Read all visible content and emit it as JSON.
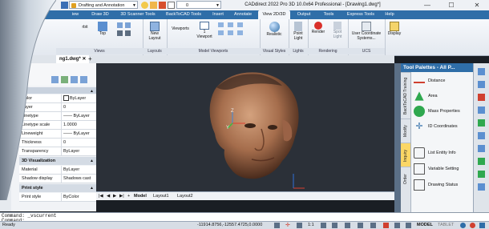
{
  "titlebar": {
    "workspace": "Drafting and Annotation",
    "layer_value": "0",
    "title": "CADdirect 2022 Pro 3D 10.0x64 Professional - [Drawing1.dwg*]"
  },
  "ribbon_tabs": [
    "iew",
    "Draw 3D",
    "3D Scanner Tools",
    "BackToCAD Tools",
    "Insert",
    "Annotate",
    "View 2D/3D",
    "Output",
    "Tools",
    "Express Tools",
    "Help"
  ],
  "active_tab": "View 2D/3D",
  "ribbon": {
    "groups": {
      "views": "Views",
      "layouts": "Layouts",
      "model_viewports": "Model Viewports",
      "visual_styles": "Visual Styles",
      "lights": "Lights",
      "rendering": "Rendering",
      "ucs": "UCS"
    },
    "orbit": "rbit",
    "top": "Top",
    "new_layout": "New Layout",
    "viewports": "Viewports",
    "one_viewport": "1 Viewport",
    "realistic": "Realistic",
    "point_light": "Point Light",
    "render": "Render",
    "spot_light": "Spot Light",
    "user_coordinate": "User Coordinate Systems...",
    "display": "Display"
  },
  "document_tab": "ng1.dwg*",
  "properties": {
    "general_rows": [
      {
        "key": "Color",
        "value": "ByLayer"
      },
      {
        "key": "Layer",
        "value": "0"
      },
      {
        "key": "Linetype",
        "value": "—— ByLayer"
      },
      {
        "key": "Linetype scale",
        "value": "1.0000"
      },
      {
        "key": "Lineweight",
        "value": "—— ByLayer"
      },
      {
        "key": "Thickness",
        "value": "0"
      },
      {
        "key": "Transparency",
        "value": "ByLayer"
      }
    ],
    "section_3d": "3D Visualization",
    "rows_3d": [
      {
        "key": "Material",
        "value": "ByLayer"
      },
      {
        "key": "Shadow display",
        "value": "Shadows cast"
      }
    ],
    "section_print": "Print style",
    "rows_print": [
      {
        "key": "Print style",
        "value": "ByColor"
      }
    ]
  },
  "viewport": {
    "axis_z": "Z",
    "axis_y": "Y"
  },
  "layout_tabs": [
    "Model",
    "Layout1",
    "Layout2"
  ],
  "tool_palette": {
    "title": "Tool Palettes - All P...",
    "vertical_tabs": [
      "BackToCAD Training",
      "Modify",
      "Inquiry",
      "Order"
    ],
    "active_vtab": "Inquiry",
    "items": [
      {
        "label": "Distance",
        "icon": "distance-icon"
      },
      {
        "label": "Area",
        "icon": "area-icon"
      },
      {
        "label": "Mass Properties",
        "icon": "mass-properties-icon"
      },
      {
        "label": "ID Coordinates",
        "icon": "id-coordinates-icon"
      },
      {
        "label": "List Entity Info",
        "icon": "list-entity-icon"
      },
      {
        "label": "Variable Setting",
        "icon": "variable-setting-icon"
      },
      {
        "label": "Drawing Status",
        "icon": "drawing-status-icon"
      }
    ]
  },
  "command": {
    "line1": "Command: _vscurrent",
    "line2": "Command:"
  },
  "status": {
    "ready": "Ready",
    "coords": "-11914.8756,-12557.4725,0.0000",
    "scale": "1:1",
    "model": "MODEL",
    "tablet": "TABLET"
  },
  "colors": {
    "ribbon_blue": "#2f6ea8",
    "viewport_bg": "#2b3038",
    "active_vtab": "#fbd766"
  }
}
